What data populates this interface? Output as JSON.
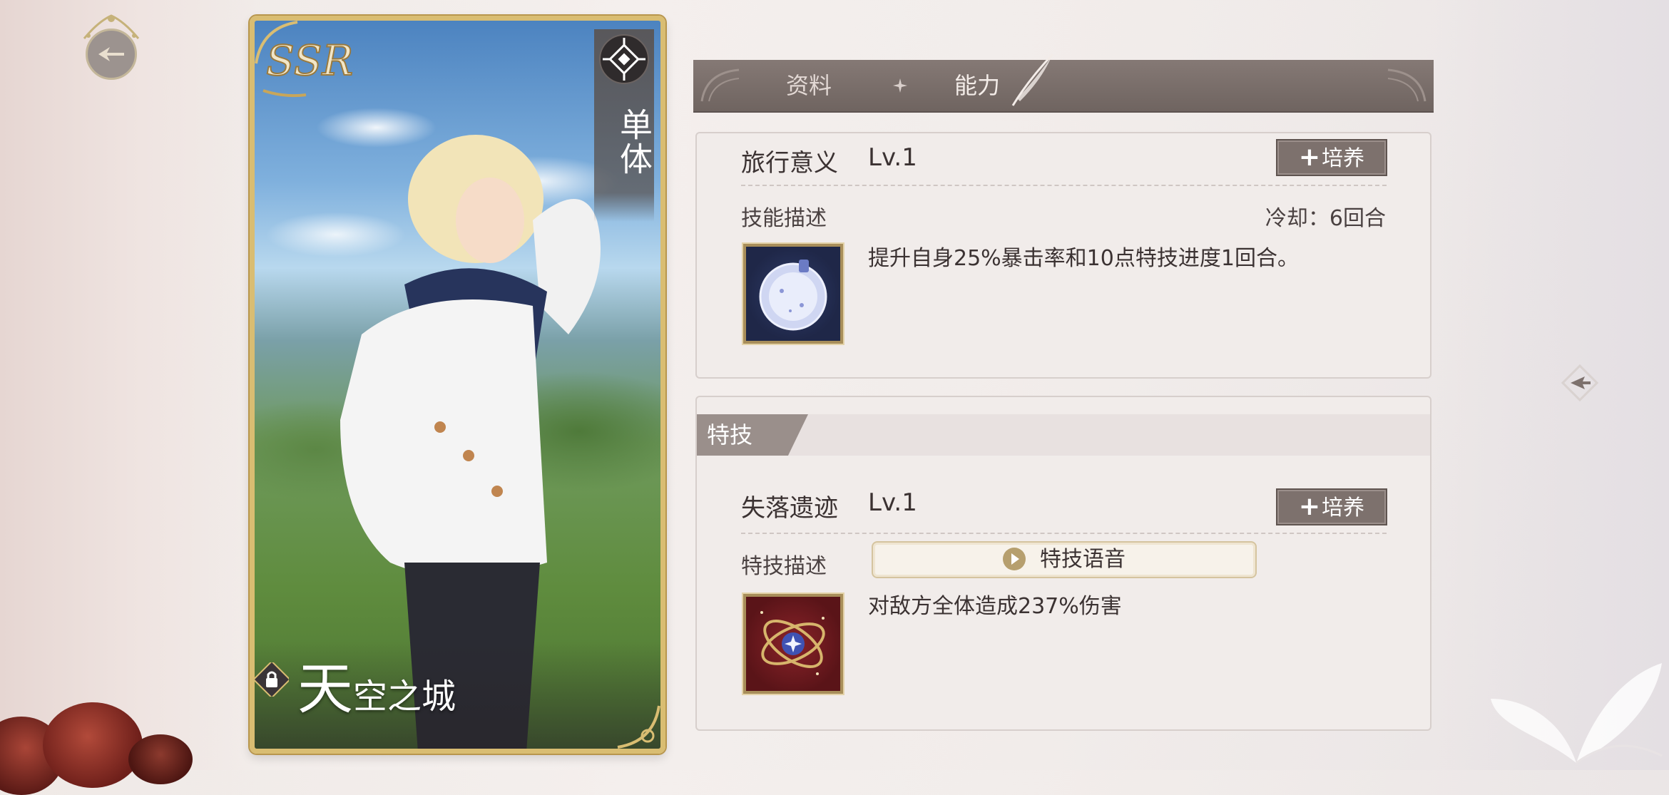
{
  "card": {
    "rarity": "SSR",
    "skill_type": "单体",
    "name": "天空之城",
    "name_first": "天",
    "name_rest": "空之城"
  },
  "tabs": [
    {
      "label": "资料",
      "active": false
    },
    {
      "label": "能力",
      "active": true
    }
  ],
  "skill": {
    "name": "旅行意义",
    "level": "Lv.1",
    "train_label": "培养",
    "desc_label": "技能描述",
    "cooldown": "冷却：6回合",
    "description": "提升自身25%暴击率和10点特技进度1回合。",
    "icon": "crystal-orb-icon"
  },
  "special": {
    "section_label": "特技",
    "name": "失落遗迹",
    "level": "Lv.1",
    "train_label": "培养",
    "desc_label": "特技描述",
    "voice_label": "特技语音",
    "description": "对敌方全体造成237%伤害",
    "icon": "armillary-sphere-icon"
  },
  "colors": {
    "tab_bar": "#7a6f6b",
    "gold_frame": "#d9bd72",
    "train_button": "#7d716d",
    "panel_bg": "#f1ecea"
  }
}
